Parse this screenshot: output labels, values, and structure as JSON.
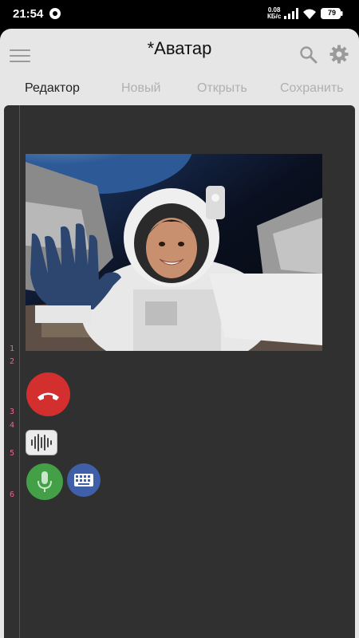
{
  "status": {
    "time": "21:54",
    "net_speed_value": "0.08",
    "net_speed_unit": "КБ/с",
    "battery": "79"
  },
  "app": {
    "title": "*Аватар"
  },
  "tabs": [
    {
      "label": "Редактор",
      "active": true
    },
    {
      "label": "Новый",
      "active": false
    },
    {
      "label": "Открыть",
      "active": false
    },
    {
      "label": "Сохранить",
      "active": false
    }
  ],
  "editor": {
    "line_numbers": [
      "1",
      "2",
      "3",
      "4",
      "5",
      "6"
    ]
  },
  "colors": {
    "accent_line_numbers": "#f06292",
    "hangup": "#d32f2f",
    "mic": "#43a047",
    "keyboard": "#3f5fa8"
  }
}
